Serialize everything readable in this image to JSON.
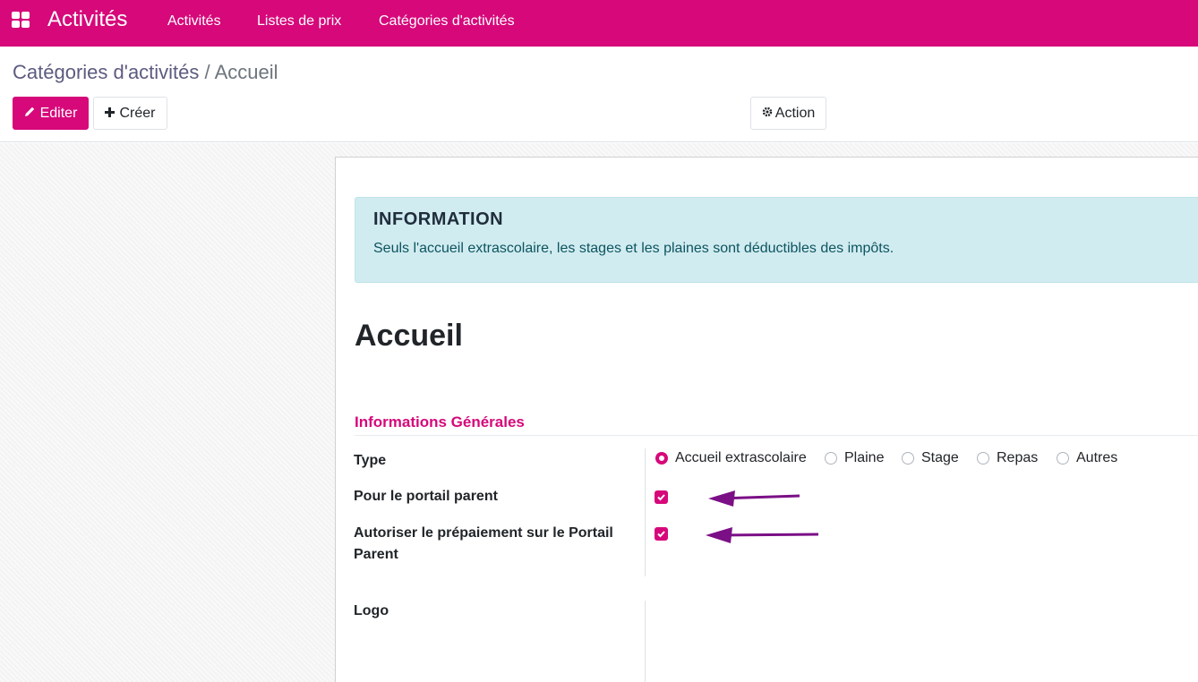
{
  "navbar": {
    "app_title": "Activités",
    "menu": [
      "Activités",
      "Listes de prix",
      "Catégories d'activités"
    ],
    "color": "#d6087a"
  },
  "breadcrumb": {
    "parent": "Catégories d'activités",
    "separator": "/",
    "current": "Accueil"
  },
  "toolbar": {
    "edit_label": "Editer",
    "create_label": "Créer",
    "action_label": "Action"
  },
  "alert": {
    "title": "INFORMATION",
    "text": "Seuls l'accueil extrascolaire, les stages et les plaines sont déductibles des impôts."
  },
  "record": {
    "title": "Accueil"
  },
  "group": {
    "title": "Informations Générales"
  },
  "fields": {
    "type_label": "Type",
    "type_options": [
      "Accueil extrascolaire",
      "Plaine",
      "Stage",
      "Repas",
      "Autres"
    ],
    "type_selected": "Accueil extrascolaire",
    "portal_label": "Pour le portail parent",
    "portal_checked": true,
    "prepay_label_line1": "Autoriser le prépaiement sur le Portail",
    "prepay_label_line2": "Parent",
    "prepay_checked": true,
    "logo_label": "Logo"
  },
  "annotation_arrow_color": "#7b0f86"
}
